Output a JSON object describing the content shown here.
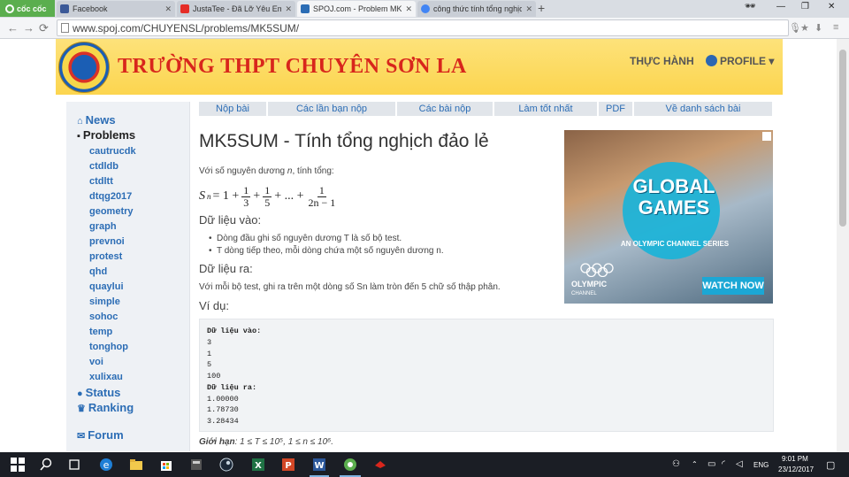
{
  "browser": {
    "home_button_label": "cốc cốc",
    "tabs": [
      {
        "title": "Facebook",
        "favicon_color": "#3b5998"
      },
      {
        "title": "JustaTee - Đã Lỡ Yêu Em N",
        "favicon_color": "#e52d27"
      },
      {
        "title": "SPOJ.com - Problem MK5",
        "favicon_color": "#2c6db5",
        "active": true
      },
      {
        "title": "công thức tính tổng nghịc",
        "favicon_color": "#4285f4"
      }
    ],
    "new_tab_label": "+",
    "url": "www.spoj.com/CHUYENSL/problems/MK5SUM/",
    "back_icon": "←",
    "forward_icon": "→",
    "reload_icon": "⟳"
  },
  "header": {
    "school_name": "TRƯỜNG THPT CHUYÊN SƠN LA",
    "nav_practice": "THỰC HÀNH",
    "nav_profile": "PROFILE ▾"
  },
  "sidebar": {
    "news": "News",
    "problems": "Problems",
    "categories": [
      "cautrucdk",
      "ctdldb",
      "ctdltt",
      "dtqg2017",
      "geometry",
      "graph",
      "prevnoi",
      "protest",
      "qhd",
      "quaylui",
      "simple",
      "sohoc",
      "temp",
      "tonghop",
      "voi",
      "xulixau"
    ],
    "status": "Status",
    "ranking": "Ranking",
    "forum": "Forum"
  },
  "problem_tabs": [
    "Nộp bài",
    "Các lần bạn nộp",
    "Các bài nộp",
    "Làm tốt nhất",
    "PDF",
    "Về danh sách bài"
  ],
  "problem": {
    "title": "MK5SUM - Tính tổng nghịch đảo lẻ",
    "intro_prefix": "Với số nguyên dương ",
    "intro_var": "n",
    "intro_suffix": ", tính tổng:",
    "formula": {
      "lhs": "S",
      "lhs_sub": "n",
      "eq": "= 1 +",
      "fracs": [
        {
          "num": "1",
          "den": "3"
        },
        {
          "num": "1",
          "den": "5"
        }
      ],
      "dots": "+ ... +",
      "last_frac": {
        "num": "1",
        "den": "2n − 1"
      }
    },
    "input_heading": "Dữ liệu vào:",
    "input_bullets": [
      "Dòng đầu ghi số nguyên dương T là số bộ test.",
      "T dòng tiếp theo, mỗi dòng chứa một số nguyên dương n."
    ],
    "output_heading": "Dữ liệu ra:",
    "output_text": "Với mỗi bộ test, ghi ra trên một dòng số Sn làm tròn đến 5 chữ số thập phân.",
    "example_heading": "Ví dụ:",
    "sample_lines": [
      {
        "text": "Dữ liệu vào:",
        "bold": true
      },
      {
        "text": "3"
      },
      {
        "text": "1"
      },
      {
        "text": "5"
      },
      {
        "text": "100"
      },
      {
        "text": "Dữ liệu ra:",
        "bold": true
      },
      {
        "text": "1.00000"
      },
      {
        "text": "1.78730"
      },
      {
        "text": "3.28434"
      }
    ],
    "limits_label": "Giới hạn",
    "limits_text": ": 1 ≤ T ≤ 10⁵, 1 ≤ n ≤ 10⁶."
  },
  "ad": {
    "headline": "GLOBAL GAMES",
    "series": "AN OLYMPIC CHANNEL SERIES",
    "brand": "OLYMPIC",
    "brand_sub": "CHANNEL",
    "cta": "WATCH NOW"
  },
  "taskbar": {
    "language": "ENG",
    "time": "9:01 PM",
    "date": "23/12/2017"
  }
}
